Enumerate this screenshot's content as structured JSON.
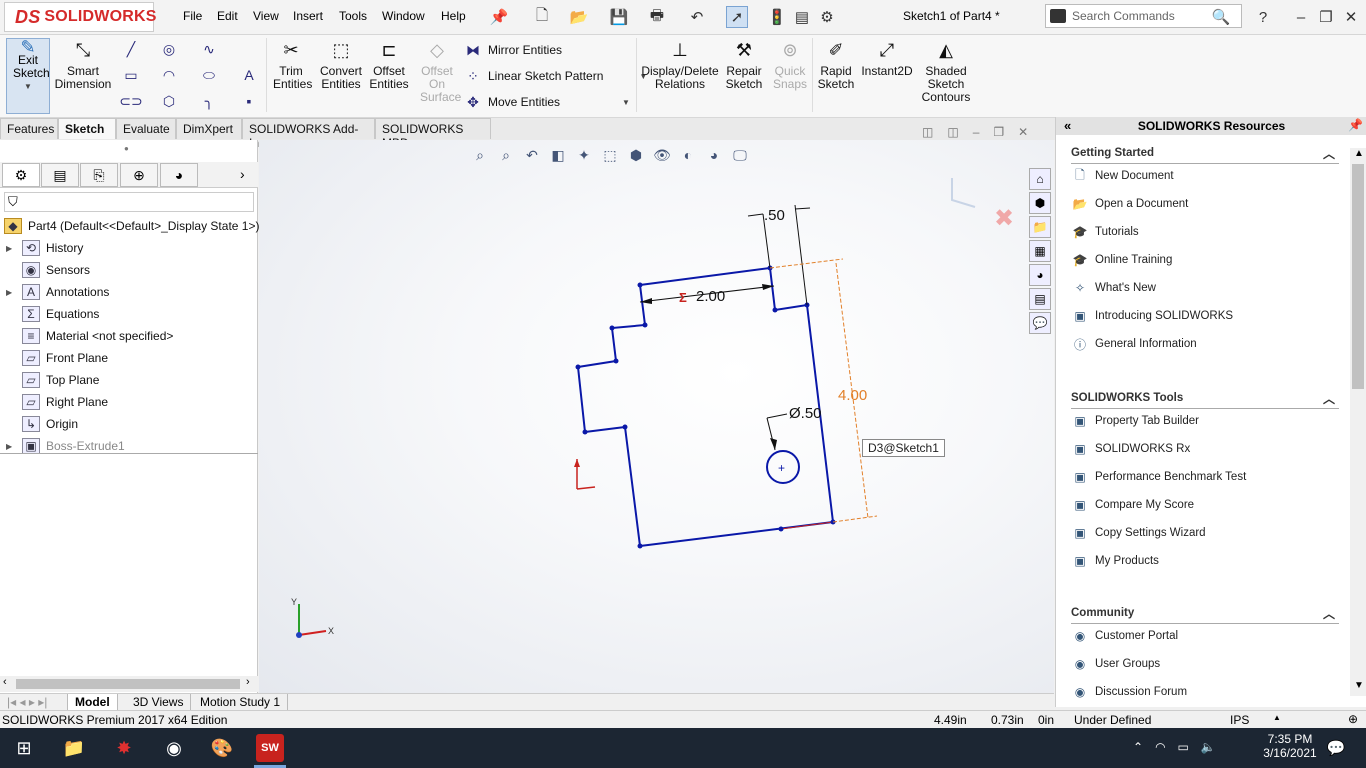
{
  "app": {
    "logo": "SOLIDWORKS",
    "doc_title": "Sketch1 of Part4 *"
  },
  "menu": [
    "File",
    "Edit",
    "View",
    "Insert",
    "Tools",
    "Window",
    "Help"
  ],
  "search": {
    "placeholder": "Search Commands"
  },
  "commands": {
    "exit_sketch": "Exit Sketch",
    "smart_dimension": "Smart Dimension",
    "trim": "Trim Entities",
    "convert": "Convert Entities",
    "offset": "Offset Entities",
    "offset_surface": "Offset On Surface",
    "mirror": "Mirror Entities",
    "linear_pattern": "Linear Sketch Pattern",
    "move": "Move Entities",
    "display_delete": "Display/Delete Relations",
    "repair": "Repair Sketch",
    "quick_snaps": "Quick Snaps",
    "rapid": "Rapid Sketch",
    "instant2d": "Instant2D",
    "shaded": "Shaded Sketch Contours"
  },
  "tabs": [
    "Features",
    "Sketch",
    "Evaluate",
    "DimXpert",
    "SOLIDWORKS Add-Ins",
    "SOLIDWORKS MBD"
  ],
  "active_tab": "Sketch",
  "tree": {
    "root": "Part4  (Default<<Default>_Display State 1>)",
    "items": [
      {
        "label": "History",
        "expandable": true,
        "icon": "history-icon"
      },
      {
        "label": "Sensors",
        "expandable": false,
        "icon": "sensors-icon"
      },
      {
        "label": "Annotations",
        "expandable": true,
        "icon": "annotations-icon"
      },
      {
        "label": "Equations",
        "expandable": false,
        "icon": "equations-icon"
      },
      {
        "label": "Material <not specified>",
        "expandable": false,
        "icon": "material-icon"
      },
      {
        "label": "Front Plane",
        "expandable": false,
        "icon": "plane-icon"
      },
      {
        "label": "Top Plane",
        "expandable": false,
        "icon": "plane-icon"
      },
      {
        "label": "Right Plane",
        "expandable": false,
        "icon": "plane-icon"
      },
      {
        "label": "Origin",
        "expandable": false,
        "icon": "origin-icon"
      },
      {
        "label": "Boss-Extrude1",
        "expandable": true,
        "icon": "extrude-icon",
        "disabled": true
      }
    ]
  },
  "sketch": {
    "dim_width": "2.00",
    "dim_small": ".50",
    "dim_height": "4.00",
    "dim_dia": "Ø.50",
    "tooltip": "D3@Sketch1",
    "triad_x": "X",
    "triad_y": "Y"
  },
  "resources": {
    "title": "SOLIDWORKS Resources",
    "sections": [
      {
        "title": "Getting Started",
        "items": [
          "New Document",
          "Open a Document",
          "Tutorials",
          "Online Training",
          "What's New",
          "Introducing SOLIDWORKS",
          "General Information"
        ]
      },
      {
        "title": "SOLIDWORKS Tools",
        "items": [
          "Property Tab Builder",
          "SOLIDWORKS Rx",
          "Performance Benchmark Test",
          "Compare My Score",
          "Copy Settings Wizard",
          "My Products"
        ]
      },
      {
        "title": "Community",
        "items": [
          "Customer Portal",
          "User Groups",
          "Discussion Forum"
        ]
      }
    ]
  },
  "bottom_tabs": [
    "Model",
    "3D Views",
    "Motion Study 1"
  ],
  "status": {
    "edition": "SOLIDWORKS Premium 2017 x64 Edition",
    "x": "4.49in",
    "y": "0.73in",
    "z": "0in",
    "state": "Under Defined",
    "units": "IPS"
  },
  "taskbar": {
    "time": "7:35 PM",
    "date": "3/16/2021"
  }
}
